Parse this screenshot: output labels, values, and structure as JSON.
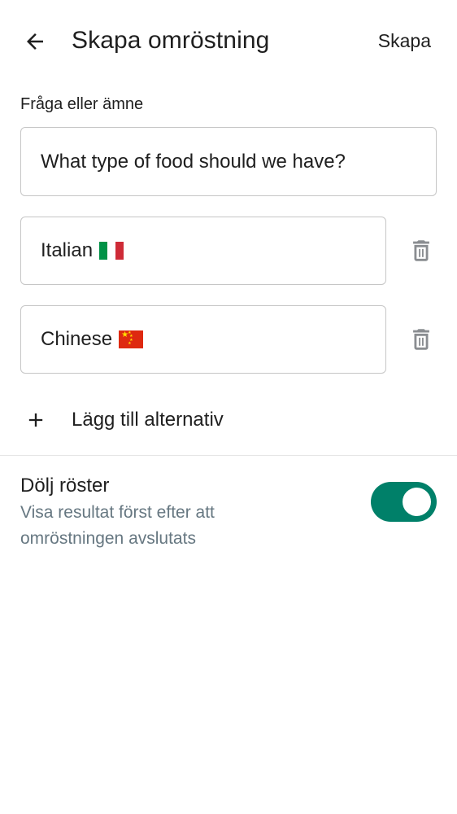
{
  "header": {
    "title": "Skapa omröstning",
    "create_label": "Skapa",
    "back_icon": "arrow-back-icon"
  },
  "question": {
    "label": "Fråga eller ämne",
    "value": "What type of food should we have?"
  },
  "options": [
    {
      "text": "Italian",
      "flag": "Italy flag"
    },
    {
      "text": "Chinese",
      "flag": "China flag"
    }
  ],
  "add_option": {
    "label": "Lägg till alternativ",
    "icon": "plus-icon"
  },
  "hide_votes": {
    "title": "Dölj röster",
    "description": "Visa resultat först efter att omröstningen avslutats",
    "enabled": true
  },
  "colors": {
    "accent": "#008069",
    "secondary_text": "#667781",
    "border": "#c6c6c6",
    "icon_gray": "#8a8d91"
  }
}
